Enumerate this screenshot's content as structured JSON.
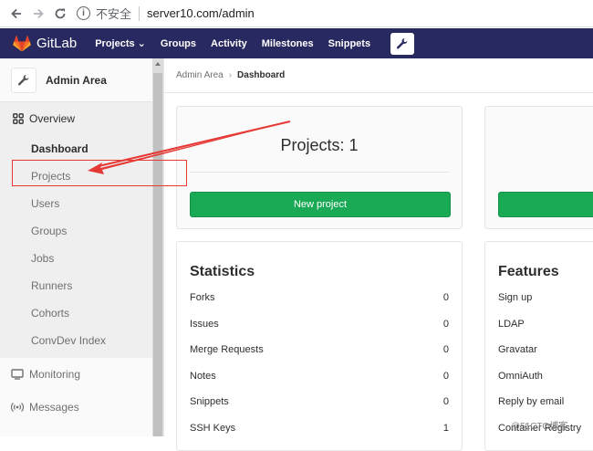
{
  "browser": {
    "back_icon": "arrow-left-icon",
    "forward_icon": "arrow-right-icon",
    "reload_icon": "reload-icon",
    "security_label": "不安全",
    "url": "server10.com/admin"
  },
  "header": {
    "logo_text": "GitLab",
    "nav": [
      "Projects ⌄",
      "Groups",
      "Activity",
      "Milestones",
      "Snippets"
    ],
    "admin_icon": "wrench-icon"
  },
  "sidebar": {
    "title": "Admin Area",
    "overview_label": "Overview",
    "sub_items": [
      "Dashboard",
      "Projects",
      "Users",
      "Groups",
      "Jobs",
      "Runners",
      "Cohorts",
      "ConvDev Index"
    ],
    "items": [
      {
        "label": "Monitoring",
        "icon": "monitor-icon"
      },
      {
        "label": "Messages",
        "icon": "broadcast-icon"
      }
    ]
  },
  "breadcrumb": {
    "parent": "Admin Area",
    "current": "Dashboard"
  },
  "projects_card": {
    "title": "Projects: 1",
    "button": "New project"
  },
  "statistics": {
    "title": "Statistics",
    "rows": [
      {
        "label": "Forks",
        "value": "0"
      },
      {
        "label": "Issues",
        "value": "0"
      },
      {
        "label": "Merge Requests",
        "value": "0"
      },
      {
        "label": "Notes",
        "value": "0"
      },
      {
        "label": "Snippets",
        "value": "0"
      },
      {
        "label": "SSH Keys",
        "value": "1"
      }
    ]
  },
  "features": {
    "title": "Features",
    "rows": [
      "Sign up",
      "LDAP",
      "Gravatar",
      "OmniAuth",
      "Reply by email",
      "Container Registry"
    ]
  },
  "watermark": "@51CTO博客",
  "colors": {
    "header_bg": "#292961",
    "green": "#1aaa55",
    "annotation_red": "#e53935"
  }
}
